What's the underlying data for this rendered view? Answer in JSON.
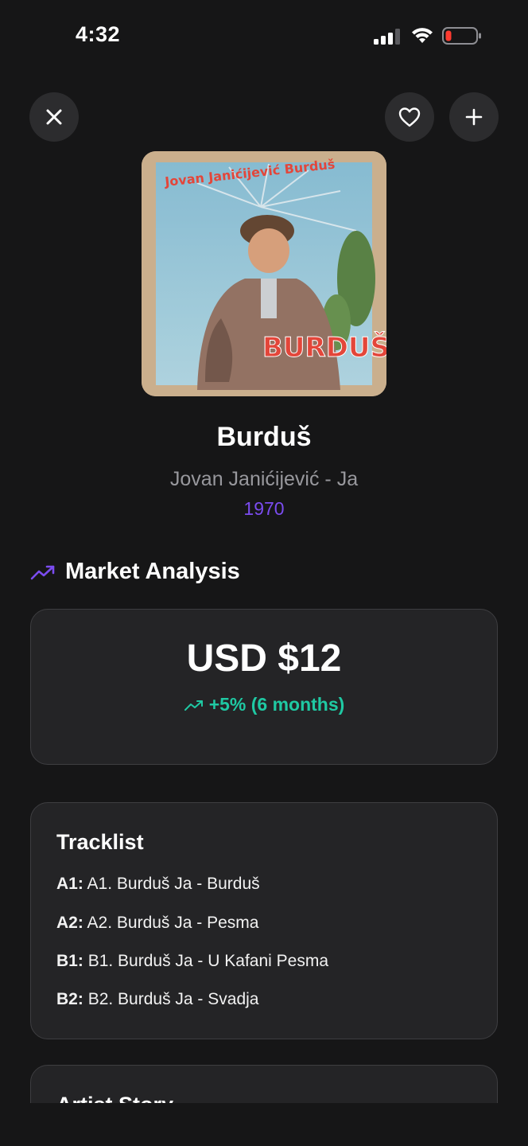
{
  "status_bar": {
    "time": "4:32"
  },
  "header": {
    "close_icon": "close-icon",
    "favorite_icon": "heart-icon",
    "add_icon": "plus-icon"
  },
  "album": {
    "title": "Burduš",
    "artist_line": "Jovan Janićijević - Ja",
    "year": "1970",
    "cover_text_top": "Jovan Janićijević Burduš",
    "cover_text_bottom": "BURDUŠ"
  },
  "market": {
    "section_title": "Market Analysis",
    "price": "USD $12",
    "change": "+5% (6 months)",
    "change_color": "#1fc9a3"
  },
  "tracklist": {
    "title": "Tracklist",
    "tracks": [
      {
        "position": "A1:",
        "name": "A1. Burduš Ja - Burduš"
      },
      {
        "position": "A2:",
        "name": "A2. Burduš Ja - Pesma"
      },
      {
        "position": "B1:",
        "name": "B1. Burduš Ja - U Kafani Pesma"
      },
      {
        "position": "B2:",
        "name": "B2. Burduš Ja - Svadja"
      }
    ]
  },
  "artist_story": {
    "title": "Artist Story"
  },
  "colors": {
    "accent": "#7b4cf0",
    "background": "#161617",
    "card": "#242426"
  }
}
